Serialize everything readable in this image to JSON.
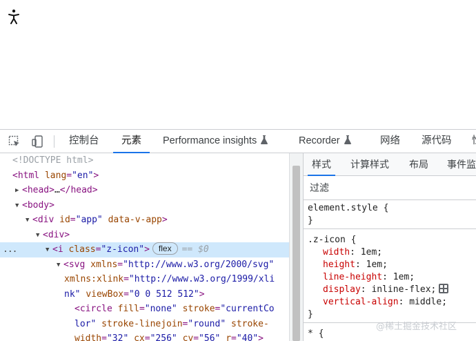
{
  "toolbar": {
    "tabs": [
      {
        "label": "控制台"
      },
      {
        "label": "元素"
      },
      {
        "label": "Performance insights"
      },
      {
        "label": "Recorder"
      },
      {
        "label": "网络"
      },
      {
        "label": "源代码"
      },
      {
        "label": "性"
      }
    ],
    "active_tab": "元素"
  },
  "elements": {
    "doctype": "<!DOCTYPE html>",
    "html_tag": "<html",
    "html_attr": "lang",
    "html_val": "\"en\"",
    "head_open": "<head>",
    "head_ellipsis": "…",
    "head_close": "</head>",
    "body_tag": "<body>",
    "div_app_tag": "<div",
    "div_app_attr1": "id",
    "div_app_val1": "\"app\"",
    "div_app_attr2": "data-v-app",
    "div_tag": "<div>",
    "i_tag": "<i",
    "i_attr": "class",
    "i_val": "\"z-icon\"",
    "flex_badge": "flex",
    "eq_label": "== $0",
    "svg_tag": "<svg",
    "svg_attr1": "xmlns",
    "svg_val1": "\"http://www.w3.org/2000/svg\"",
    "svg_attr2": "xmlns:xlink",
    "svg_val2a": "\"http://www.w3.org/1999/xli",
    "svg_val2b": "nk\"",
    "svg_attr3": "viewBox",
    "svg_val3": "\"0 0 512 512\"",
    "circle_tag": "<circle",
    "circle_attr1": "fill",
    "circle_val1": "\"none\"",
    "circle_attr2": "stroke",
    "circle_val2a": "\"currentCo",
    "circle_val2b": "lor\"",
    "circle_attr3": "stroke-linejoin",
    "circle_val3": "\"round\"",
    "circle_attr4a": "stroke-",
    "circle_attr4b": "width",
    "circle_val4": "\"32\"",
    "circle_attr5": "cx",
    "circle_val5": "\"256\"",
    "circle_attr6": "cy",
    "circle_val6": "\"56\"",
    "circle_attr7": "r",
    "circle_val7": "\"40\"",
    "selected_dots": "..."
  },
  "styles": {
    "sub_tabs": [
      {
        "label": "样式"
      },
      {
        "label": "计算样式"
      },
      {
        "label": "布局"
      },
      {
        "label": "事件监"
      }
    ],
    "filter_placeholder": "过滤",
    "element_style_selector": "element.style {",
    "close_brace": "}",
    "rule_selector": ".z-icon {",
    "props": [
      {
        "name": "width",
        "value": "1em;"
      },
      {
        "name": "height",
        "value": "1em;"
      },
      {
        "name": "line-height",
        "value": "1em;"
      },
      {
        "name": "display",
        "value": "inline-flex;"
      },
      {
        "name": "vertical-align",
        "value": "middle;"
      }
    ],
    "universal_selector": "* {"
  },
  "watermark": "@稀土掘金技术社区",
  "colors": {
    "accent": "#1a73e8",
    "tag": "#881280",
    "attr": "#994500",
    "value": "#1a1aa6",
    "css_prop": "#c80000",
    "selection": "#cfe8fc"
  }
}
